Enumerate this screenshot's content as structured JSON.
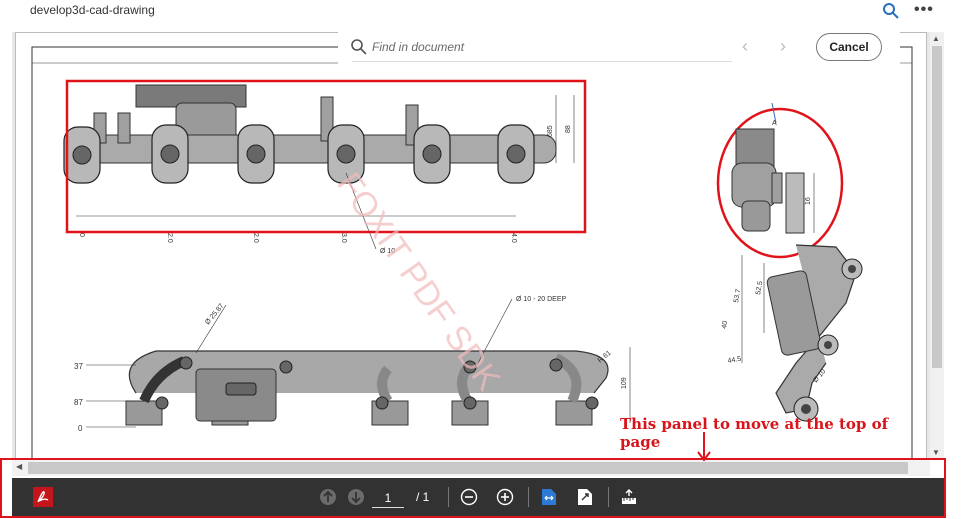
{
  "window": {
    "title": "develop3d-cad-drawing"
  },
  "find_bar": {
    "placeholder": "Find in document",
    "cancel_label": "Cancel"
  },
  "drawing": {
    "watermark": "FOXIT PDF SDK",
    "dims_top": [
      "685",
      "88",
      "0",
      "2.0",
      "2.0",
      "3.0",
      "4.0"
    ],
    "dims_mid": [
      "Ø 10",
      "Ø 10 - 20 DEEP",
      "Ø 25.87",
      "R 61",
      "109",
      "87",
      "37",
      "0"
    ],
    "dims_right": [
      "A",
      "16",
      "53.7",
      "52.5",
      "40",
      "44.5",
      "Ø 10"
    ]
  },
  "toolbar": {
    "page_value": "1",
    "page_total": "/ 1"
  },
  "annotation": {
    "text": "This panel to move at the top of page",
    "color": "#e0131a"
  }
}
